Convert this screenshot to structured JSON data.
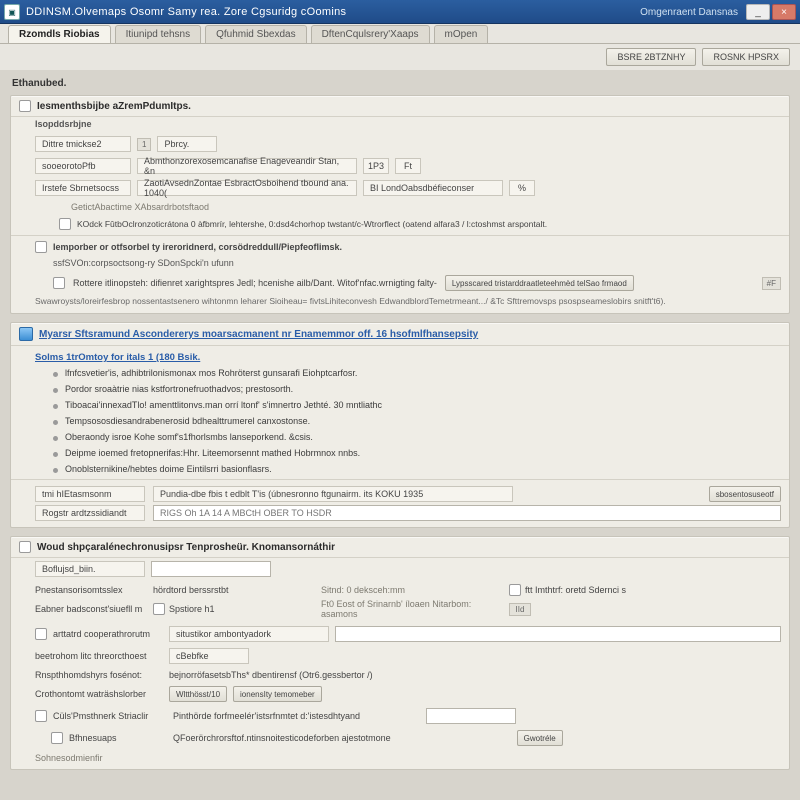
{
  "window": {
    "title": "DDINSM.Olvemaps Osomr Samy rea. Zore Cgsuridg cOomins",
    "right_text": "Omgenraent Dansnas",
    "sys_min": "_",
    "sys_close": "×"
  },
  "tabs": {
    "active": "Rzomdls Riobias",
    "items": [
      "Itiunipd tehsns",
      "Qfuhmid Sbexdas",
      "DftenCqulsrery'Xaaps",
      "mOpen"
    ]
  },
  "topbuttons": {
    "left": "BSRE 2BTZNHY",
    "right": "ROSNK HPSRX"
  },
  "header": "Ethanubed.",
  "sec1": {
    "title": "Iesmenthsbijbe aZremPdumItps.",
    "subhead": "Isopddsrbjne",
    "r1_label": "Dittre tmickse2",
    "r1_tag": "1",
    "r1_value": "Pbrcy.",
    "r2_label": "sooeorotoPfb",
    "r2_value": "Abmthonzorexosemcanafise Enageveandir Stan, &n",
    "r2_num": "1P3",
    "r2_box": "Ft",
    "r3_label": "Irstefe Sbrnetsocss",
    "r3_value": "ZaotiAvsednZontae EsbractOsboihend tbound ana. 1040(",
    "r3_side": "BI LondOabsdbéfieconser",
    "r3_num": "%",
    "note1_label": "GetictAbactime XAbsardrbotsftaod",
    "note1": "KOdck FûtbOclronzoticrátona 0 àfbmrír, lehtershe, 0:dsd4chorhop twstant/c-Wtrorflect (oatend alfara3 / l:ctoshmst arspontalt.",
    "sec1b_title": "Iemporber or otfsorbel ty ireroridnerd, corsödreddull/Piepfeoflimsk.",
    "sec1b_sub": "ssfSVOn:corpsoctsong-ry SDonSpcki'n ufunn",
    "sec1b_opt": "Rottere itlinopsteh: difienret xarightspres Jedl;  hcenishe ailb/Dant. Witof'nfac.wrnigting falty-",
    "sec1b_btn": "Lypsscared tristarddraatleteehmèd telSao frmaod",
    "foot": "Swawroysts/loreirfesbrop nossentastsenero wihtonmn leharer Sioiheau= fivtsLihiteconvesh EdwandblordTemetrmeant.../ &Tc Sfttremovsps psospseameslobirs snitft't6).",
    "pill": "#F"
  },
  "sec2": {
    "title": "Myarsr Sftsramund Ascondererys moarsacmanent nr Enamemmor off. 16 hsofmlfhansepsity",
    "linktitle": "Solms 1trOmtoy for itals 1 (180 Bsik.",
    "items": [
      "lfnfcsvetier'is, adhibtrilonismonax mos Rohröterst gunsarafi Eiohptcarfosr.",
      "Pordor sroaàtrie nias kstfortronefruothadvos; prestosorth.",
      "Tiboacai'innexadTlo! amenttlitonvs.man orrí ltonf' s'imnertro Jethté. 30 mntliathc",
      "Tempsososdiesandrabenerosid bdhealttrumerel canxostonse.",
      "Oberaondy isroe Kohe somf's1fhorlsmbs lanseporkend. &csis.",
      "Deipme ioemed fretopnerifas:Hhr. Liteemorsennt mathed Hobrmnox nnbs.",
      "Onoblsternikine/hebtes doime Eintilsrri basionflasrs."
    ],
    "r_label1": "tmi hIEtasmsonm",
    "r_val1": "Pundia-dbe fbis t edblt T'is (úbnesronno ftgunairm. its KOKU 1935",
    "r_btn": "sbosentosuseotf",
    "r_label2": "Rogstr ardtzssidiandt",
    "r_val2": "RIGS Oh 1A 14 A MBCtH OBER TO HSDR"
  },
  "sec3": {
    "title": "Woud shpçaralénechronusipsr Tenprosheür. Knomansornáthir",
    "r1_l": "Boflujsd_biin.",
    "r1_r": "",
    "r2_l": "Pnestansorisomtsslex",
    "r2_r": "hördtord berssrstbt",
    "r2_c3": "Sitnd: 0 deksceh:mm",
    "r2_c4": "ftt Imthtrf: oretd Sdernci s",
    "r3_l": "Eabner badsconst'siuefll m",
    "r3_r": "Spstiore h1",
    "r3_c3": "Ft0 Eost of Srinarnb' íloaen Nitarbom: asamons",
    "r3_c4_tag": "IId",
    "r4_l": "arttatrd cooperathrorutm",
    "r4_r": "situstikor ambontyadork",
    "r4_box": "",
    "r5_l": "beetrohom litc threorcthoest",
    "r5_r": "cBebfke",
    "r6_l": "Rnspthhomdshyrs fosénot:",
    "r6_r": "bejnorröfasetsbThs* dbentirensf (Otr6.gessbertor /)",
    "r7_l": "Crothontomt waträshslorber",
    "r7_btn1": "Wltthösst/10",
    "r7_btn2": "ionensIty temomeber",
    "r8_l": "Cüls'Pmsthnerk Striaclir",
    "r8_r": "Pinthörde forfmeelér'istsrfnmtet d:'istesdhtyand",
    "r9_l": "Bfhnesuaps",
    "r9_r": "QFoerörchrorsftof.ntinsnoitesticodeforben ajestotmone",
    "r9_btn": "Gwotréle",
    "foot_l": "Sohnesodmienfir"
  }
}
